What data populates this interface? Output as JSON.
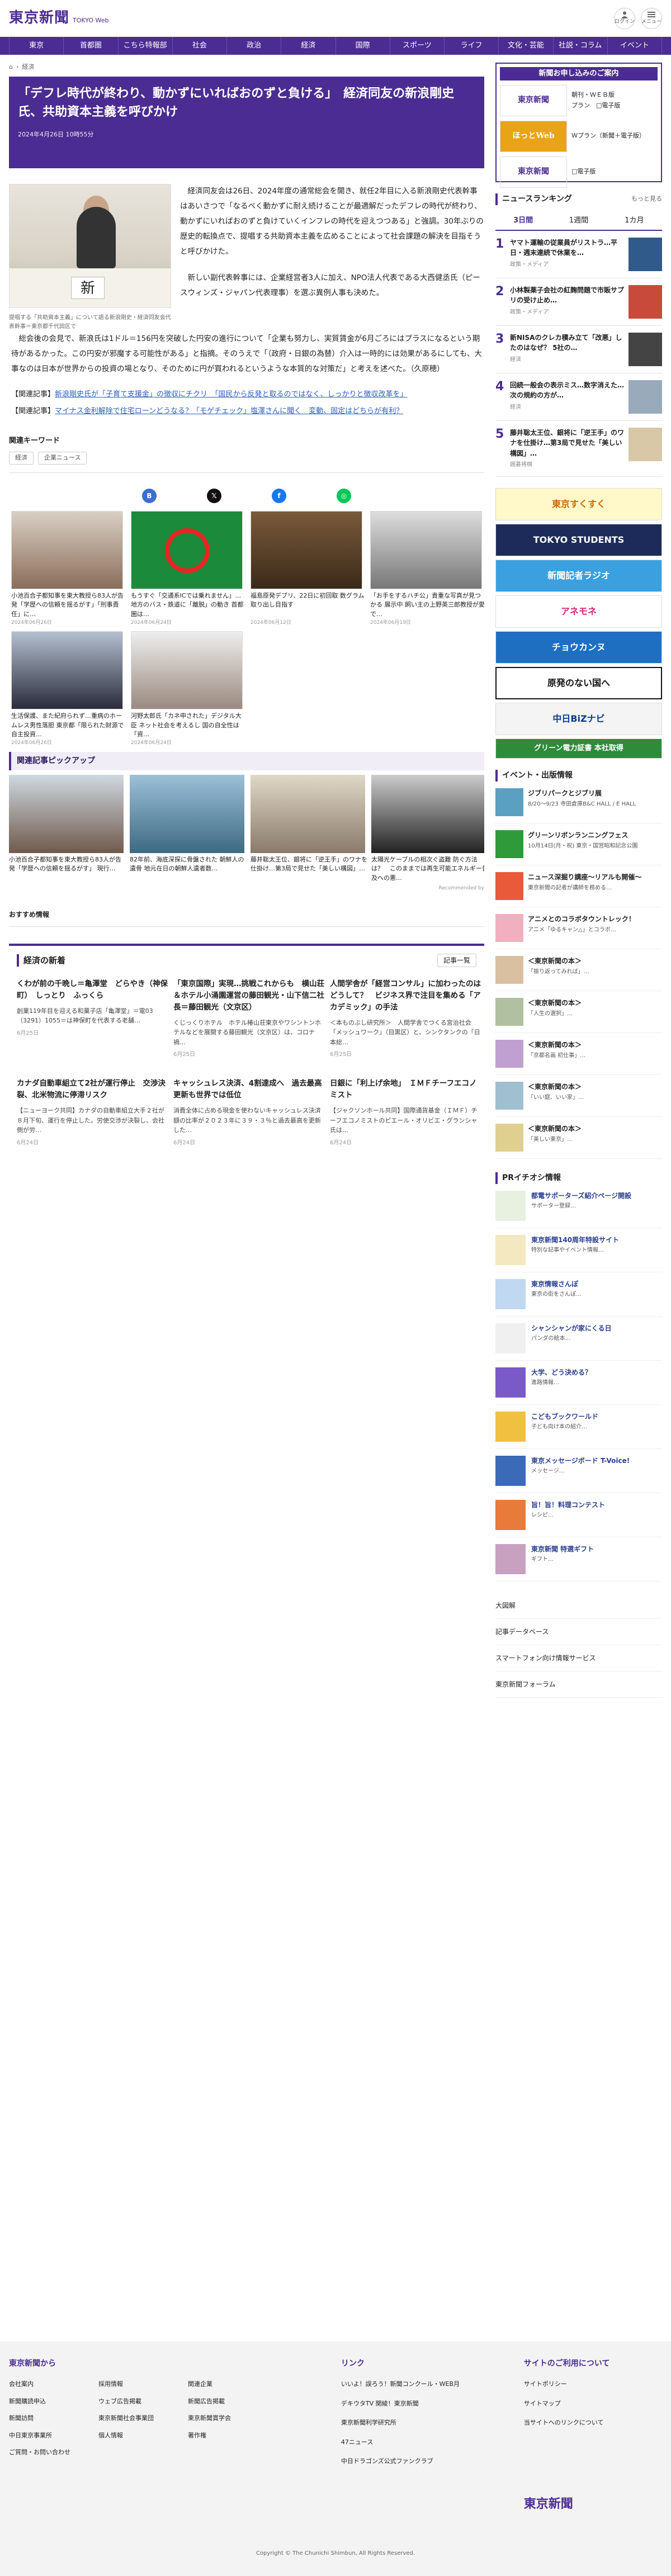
{
  "header": {
    "logo": "東京新聞",
    "logo_sub": "TOKYO Web",
    "login": "ログイン",
    "menu": "メニュー"
  },
  "gnav": [
    "東京",
    "首都圏",
    "こちら特報部",
    "社会",
    "政治",
    "経済",
    "国際",
    "文化・芸能",
    "スポーツ",
    "ライフ",
    "文化・芸能",
    "社説・コラム",
    "イベント"
  ],
  "crumb": [
    "トップ",
    "経済"
  ],
  "article": {
    "title": "「デフレ時代が終わり、動かずにいればおのずと負ける」　経済同友の新浪剛史氏、共助資本主義を呼びかけ",
    "date": "2024年4月26日 10時55分",
    "caption": "提唱する「共助資本主義」について語る新浪剛史・経済同友会代表幹事＝東京都千代田区で",
    "paragraphs": [
      "経済同友会は26日、2024年度の通常総会を開き、就任2年目に入る新浪剛史代表幹事はあいさつで「なるべく動かずに耐え続けることが最適解だったデフレの時代が終わり、動かずにいればおのずと負けていくインフレの時代を迎えつつある」と強調。30年ぶりの歴史的転換点で、提唱する共助資本主義を広めることによって社会課題の解決を目指そうと呼びかけた。",
      "新しい副代表幹事には、企業経営者3人に加え、NPO法人代表である大西健丞氏（ピースウィンズ・ジャパン代表理事）を選ぶ異例人事も決めた。",
      "総会後の会見で、新浪氏は1ドル＝156円を突破した円安の進行について「企業も努力し、実質賃金が6月ごろにはプラスになるという期待があるかった。この円安が邪魔する可能性がある」と指摘。そのうえで「（政府・日銀の為替）介入は一時的には効果があるにしても、大事なのは日本が世界からの投資の場となり、そのために円が買われるというような本質的な対策だ」と考えを述べた。（久原穂）"
    ],
    "related": [
      {
        "prefix": "【関連記事】",
        "text": "新浪剛史氏が「子育て支援金」の徴収にチクリ　「国民から反発と取るのではなく、しっかりと徴収改革を」"
      },
      {
        "prefix": "【関連記事】",
        "text": "マイナス金利解除で住宅ローンどうなる？「モゲチェック」塩澤さんに聞く　変動、固定はどちらが有利？"
      }
    ],
    "keywords_title": "関連キーワード",
    "keywords": [
      "経済",
      "企業ニュース"
    ]
  },
  "thumbs": [
    {
      "cap": "小池百合子都知事を東大教授ら83人が告発「学歴への信頼を揺るがす」「刑事責任」に…",
      "d": "2024年06月26日"
    },
    {
      "cap": "もうすぐ「交通系ICでは乗れません」…地方のバス・鉄道に「離脱」の動き 首都圏は…",
      "d": "2024年06月24日"
    },
    {
      "cap": "福島原発デブリ、22日に初回取 数グラム取り出し目指す",
      "d": "2024年06月12日"
    },
    {
      "cap": "「お手をするハチ公」貴重な写真が見つかる 展示中 飼い主の上野英三郎教授が愛で…",
      "d": "2024年06月19日"
    },
    {
      "cap": "生活保護、また紀府られず…重病のホームレス男性落胆 東京都「限られた財源で自主投資…",
      "d": "2024年06月26日"
    },
    {
      "cap": "河野太郎氏「カネ申された」デジタル大臣 ネット社会を考えるし 国の自全性は「資…",
      "d": "2024年06月24日"
    }
  ],
  "pickup": {
    "title": "関連記事ピックアップ",
    "items": [
      "小池百合子都知事を東大教授ら83人が告発「学歴への信頼を揺るがす」 現行…",
      "82年前、海底深探に骨盤された 朝鮮人の遺骨 地元在日の朝鮮人遺者数…",
      "藤井聡太王位、銀将に「逆王手」のワナを仕掛け…第3局で見せた「美しい構図」…",
      "太陽光ケーブルの相次ぐ盗難 防ぐ方法は？　このままでは再生可能エネルギー普及への悪…"
    ],
    "recommended": "Recommended by"
  },
  "osusume": "おすすめ情報",
  "econ": {
    "title": "経済の新着",
    "more": "記事一覧",
    "items": [
      {
        "h": "くわが前の千晩し＝亀澤堂　どらやき（神保町）　しっとり　ふっくら",
        "p": "創業119年目を迎える和菓子店「亀澤堂」＝電03（3291）1055＝は神保町を代表する老舗…",
        "d": "6月25日"
      },
      {
        "h": "「東京国際」実現…挑戦これからも　横山荘＆ホテル小涌園運営の藤田観光・山下信二社長＝藤田観光（文京区）",
        "p": "くじっくりホテル　ホテル椿山荘東京やワシントンホテルなどを展開する藤田観光（文京区）は、コロナ禍…",
        "d": "6月25日"
      },
      {
        "h": "人間学舎が「経営コンサル」に加わったのはどうして？　ビジネス界で注目を集める「アカデミック」の手法",
        "p": "＜本ものぶし研究所＞　人間学舎でつくる宮治社会「メッシュワーク」（目黒区）と、シンクタンクの「日本総…",
        "d": "6月25日"
      },
      {
        "h": "カナダ自動車組立て2社が運行停止　交渉決裂、北米物流に停滞リスク",
        "p": "【ニューヨーク共同】カナダの自動車組立大手２社が８月下旬、運行を停止した。労使交渉が決裂し、会社側が労…",
        "d": "6月24日"
      },
      {
        "h": "キャッシュレス決済、4割達成へ　過去最高更新も世界では低位",
        "p": "消費全体に占める現金を使わないキャッシュレス決済額の比率が２０２３年に３９・３％と過去最高を更新した…",
        "d": "6月24日"
      },
      {
        "h": "日銀に「利上げ余地」　ＩＭＦチーフエコノミスト",
        "p": "【ジャクソンホール共同】国際通貨基金（ＩＭＦ）チーフエコノミストのピエール・オリビエ・グランシャ氏は…",
        "d": "6月24日"
      }
    ]
  },
  "side": {
    "ad": {
      "title": "新聞お申し込みのご案内",
      "lines": [
        "朝刊・ＷＥＢ版",
        "プラン　□電子版",
        "Ｗプラン（新聞＋電子版）",
        "□電子版"
      ]
    },
    "ranking": {
      "title": "ニュースランキング",
      "more": "もっと見る",
      "tabs": [
        "3日間",
        "1週間",
        "1カ月"
      ],
      "items": [
        {
          "t": "ヤマト運輸の従業員がリストラ…平日・週末連続で休業を…",
          "c": "政策・メディア"
        },
        {
          "t": "小林製薬子会社の紅麹問題で市販サプリの受け止め…",
          "c": "政策・メディア"
        },
        {
          "t": "新NISAのクレカ積み立て「改悪」したのはなぜ？ 5社の…",
          "c": "経済"
        },
        {
          "t": "回続一般会の表示ミス…数字消えた…次の規約の方が…",
          "c": "経済"
        },
        {
          "t": "藤井聡太王位、銀将に「逆王手」のワナを仕掛け…第3局で見せた「美しい構図」…",
          "c": "囲碁将棋"
        }
      ]
    },
    "banners": [
      "東京すくすく",
      "TOKYO STUDENTS",
      "新聞記者ラジオ",
      "アネモネ",
      "チョウカンヌ",
      "原発のない国へ",
      "中日BiZナビ",
      "グリーン電力証書 本社取得"
    ],
    "events": {
      "title": "イベント・出版情報",
      "items": [
        {
          "t": "ジブリパークとジブリ展",
          "s": "8/20〜9/23 寺田倉庫B&C HALL / E HALL"
        },
        {
          "t": "グリーンリボンランニングフェス",
          "s": "10月14日(月・祝) 東京・国営昭和記念公園"
        },
        {
          "t": "ニュース深掘り講座〜リアルも開催〜",
          "s": "東京新聞の記者が講師を務める…"
        },
        {
          "t": "アニメとのコラボタウントレック！",
          "s": "アニメ「ゆるキャン△」とコラボ…"
        },
        {
          "t": "＜東京新聞の本＞",
          "s": "「振り返ってみれば」…"
        },
        {
          "t": "＜東京新聞の本＞",
          "s": "「人生の選択」…"
        },
        {
          "t": "＜東京新聞の本＞",
          "s": "「京都名画 初仕事」…"
        },
        {
          "t": "＜東京新聞の本＞",
          "s": "「いい庭、いい家」…"
        },
        {
          "t": "＜東京新聞の本＞",
          "s": "「美しい東京」…"
        }
      ]
    },
    "pr": {
      "title": "PRイチオシ情報",
      "items": [
        {
          "t": "都電サポーターズ紹介ページ開設",
          "s": "サポーター登録…"
        },
        {
          "t": "東京新聞140周年特設サイト",
          "s": "特別な記事やイベント情報…"
        },
        {
          "t": "東京情報さんぽ",
          "s": "東京の街をさんぽ…"
        },
        {
          "t": "シャンシャンが家にくる日",
          "s": "パンダの絵本…"
        },
        {
          "t": "大学、どう決める？",
          "s": "進路情報…"
        },
        {
          "t": "こどもブックワールド",
          "s": "子ども向け本の紹介…"
        },
        {
          "t": "東京メッセージボード T-Voice!",
          "s": "メッセージ…"
        },
        {
          "t": "旨！旨！料理コンテスト",
          "s": "レシピ…"
        },
        {
          "t": "東京新聞 特選ギフト",
          "s": "ギフト…"
        }
      ]
    },
    "links": [
      "大図解",
      "記事データベース",
      "スマートフォン向け情報サービス",
      "東京新聞フォーラム"
    ]
  },
  "footer": {
    "c1": {
      "title": "東京新聞から",
      "items": [
        "会社案内",
        "採用情報",
        "関連企業",
        "新聞購読申込",
        "ウェブ広告掲載",
        "新聞広告掲載",
        "新聞訪問",
        "東京新聞社会事業団",
        "東京新聞賞学会",
        "中日東京事業所",
        "個人情報",
        "著作権",
        "ご質問・お問い合わせ"
      ]
    },
    "c2": {
      "title": "リンク",
      "items": [
        "いいよ！誤ろう！新聞コンクール・WEB月",
        "デキウタTV 関綾！東京新聞",
        "東京新聞利学研究所",
        "47ニュース",
        "中日ドラゴンズ公式ファンクラブ"
      ]
    },
    "c3": {
      "title": "サイトのご利用について",
      "items": [
        "サイトポリシー",
        "サイトマップ",
        "当サイトへのリンクについて"
      ]
    },
    "copyright": "Copyright © The Chunichi Shimbun, All Rights Reserved."
  },
  "colors": {
    "brand": "#4b2c92"
  }
}
